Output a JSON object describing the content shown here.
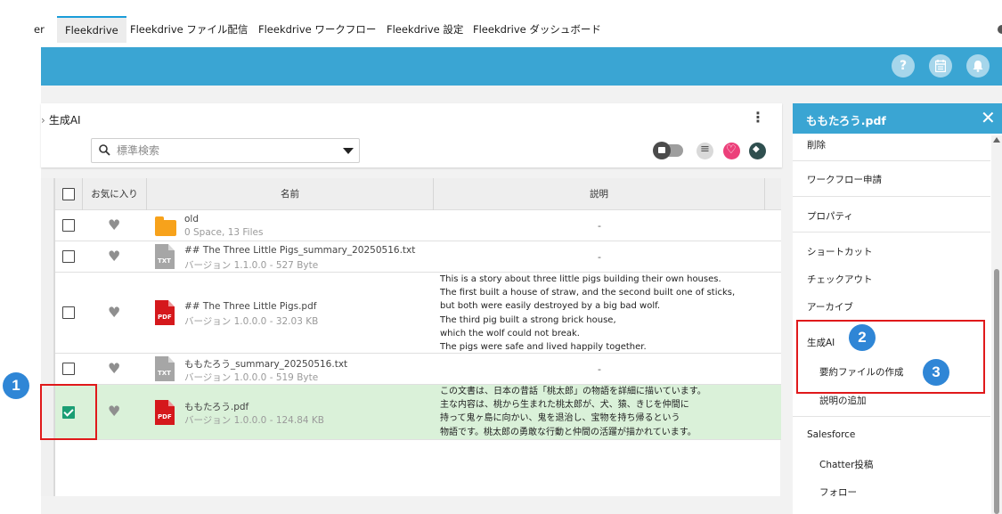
{
  "tabs": [
    "er",
    "Fleekdrive",
    "Fleekdrive ファイル配信",
    "Fleekdrive ワークフロー",
    "Fleekdrive 設定",
    "Fleekdrive ダッシュボード"
  ],
  "header": {
    "icons": [
      "help-icon",
      "calendar-icon",
      "bell-icon"
    ],
    "accent": "#3aa5d3"
  },
  "breadcrumb": {
    "current": "生成AI"
  },
  "search": {
    "placeholder": "標準検索",
    "value": ""
  },
  "table": {
    "columns": [
      "お気に入り",
      "名前",
      "説明"
    ],
    "rows": [
      {
        "name": "old",
        "meta": "0 Space, 13 Files",
        "type": "folder",
        "checked": false,
        "description": "-"
      },
      {
        "name": "## The Three Little Pigs_summary_20250516.txt",
        "meta": "バージョン 1.1.0.0 - 527 Byte",
        "type": "txt",
        "checked": false,
        "description": "-"
      },
      {
        "name": "## The Three Little Pigs.pdf",
        "meta": "バージョン 1.0.0.0 - 32.03 KB",
        "type": "pdf",
        "checked": false,
        "description_lines": [
          "This is a story about three little pigs building their own houses.",
          "The first built a house of straw, and the second built one of sticks,",
          "but both were easily destroyed by a big bad wolf.",
          "The third pig built a strong brick house,",
          "which the wolf could not break.",
          "The pigs were safe and lived happily together."
        ]
      },
      {
        "name": "ももたろう_summary_20250516.txt",
        "meta": "バージョン 1.0.0.0 - 519 Byte",
        "type": "txt",
        "checked": false,
        "description": "-"
      },
      {
        "name": "ももたろう.pdf",
        "meta": "バージョン 1.0.0.0 - 124.84 KB",
        "type": "pdf",
        "checked": true,
        "description_lines": [
          "この文書は、日本の昔話「桃太郎」の物語を詳細に描いています。",
          "主な内容は、桃から生まれた桃太郎が、犬、猿、きじを仲間に",
          "持って鬼ヶ島に向かい、鬼を退治し、宝物を持ち帰るという",
          "物語です。桃太郎の勇敢な行動と仲間の活躍が描かれています。"
        ]
      }
    ]
  },
  "side_panel": {
    "title": "ももたろう.pdf",
    "close": "✕",
    "items": [
      "削除",
      "ワークフロー申請",
      "プロパティ",
      "ショートカット",
      "チェックアウト",
      "アーカイブ",
      "生成AI",
      "要約ファイルの作成",
      "説明の追加",
      "Salesforce",
      "Chatter投稿",
      "フォロー"
    ]
  },
  "annotations": {
    "badges": [
      "1",
      "2",
      "3"
    ],
    "color": "#e0191b",
    "badge_color": "#2f86d6"
  }
}
